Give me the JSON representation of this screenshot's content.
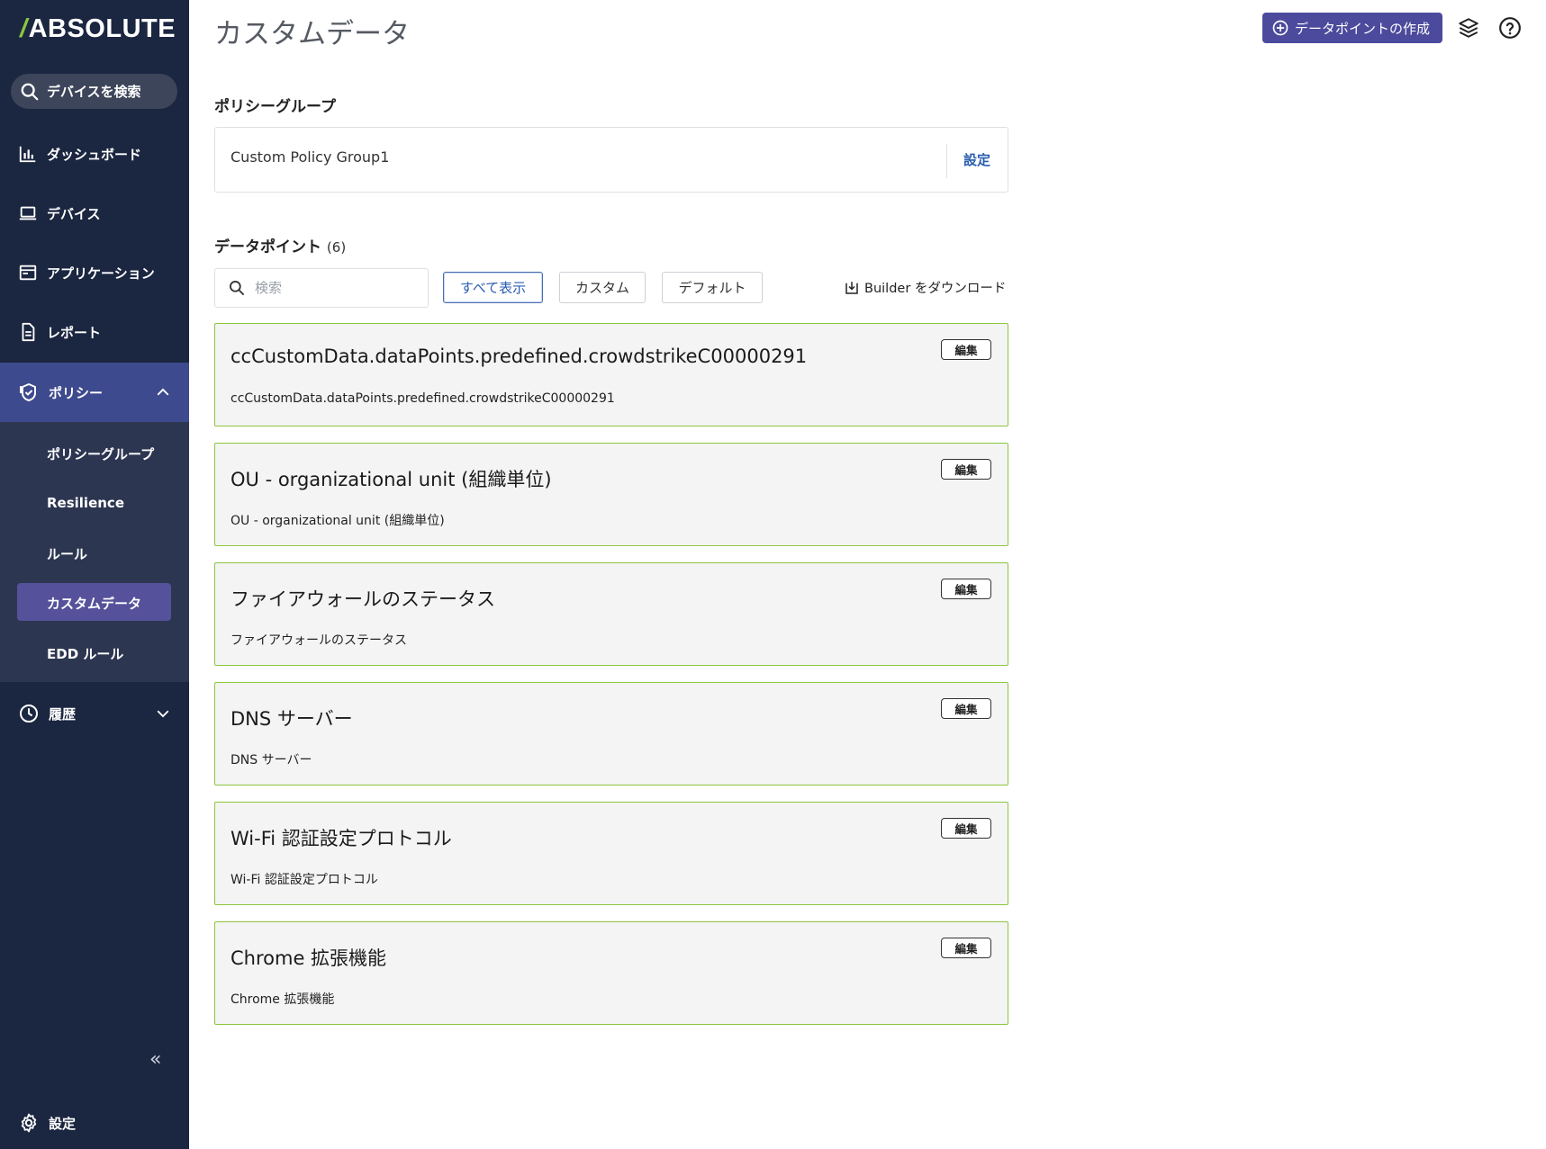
{
  "app": {
    "logo": "ABSOLUTE",
    "logo_slash": "/"
  },
  "sidebar": {
    "search_label": "デバイスを検索",
    "items": [
      {
        "label": "ダッシュボード",
        "icon": "bar-chart-icon"
      },
      {
        "label": "デバイス",
        "icon": "laptop-icon"
      },
      {
        "label": "アプリケーション",
        "icon": "window-icon"
      },
      {
        "label": "レポート",
        "icon": "document-icon"
      }
    ],
    "policy": {
      "label": "ポリシー",
      "icon": "shield-icon",
      "sub_items": [
        "ポリシーグループ",
        "Resilience",
        "ルール",
        "カスタムデータ",
        "EDD ルール"
      ]
    },
    "history_label": "履歴",
    "settings_label": "設定",
    "collapse_glyph": "«"
  },
  "header": {
    "title": "カスタムデータ",
    "create_button": "データポイントの作成"
  },
  "policy_group": {
    "heading": "ポリシーグループ",
    "name": "Custom Policy Group1",
    "set_link": "設定"
  },
  "datapoints": {
    "heading": "データポイント",
    "count": "(6)",
    "search_placeholder": "検索",
    "filters": [
      "すべて表示",
      "カスタム",
      "デフォルト"
    ],
    "active_filter": "すべて表示",
    "download_label": "Builder をダウンロード",
    "edit_label": "編集",
    "items": [
      {
        "title": "ccCustomData.dataPoints.predefined.crowdstrikeC00000291",
        "subtitle": "ccCustomData.dataPoints.predefined.crowdstrikeC00000291"
      },
      {
        "title": "OU - organizational unit (組織単位)",
        "subtitle": "OU - organizational unit (組織単位)"
      },
      {
        "title": "ファイアウォールのステータス",
        "subtitle": "ファイアウォールのステータス"
      },
      {
        "title": "DNS サーバー",
        "subtitle": "DNS サーバー"
      },
      {
        "title": "Wi-Fi 認証設定プロトコル",
        "subtitle": "Wi-Fi 認証設定プロトコル"
      },
      {
        "title": "Chrome 拡張機能",
        "subtitle": "Chrome 拡張機能"
      }
    ]
  },
  "colors": {
    "sidebar_bg": "#1b2640",
    "policy_active": "#3e4a8e",
    "accent": "#4c4a9c",
    "card_border": "#8dc63f",
    "logo_slash": "#8dc63f"
  }
}
